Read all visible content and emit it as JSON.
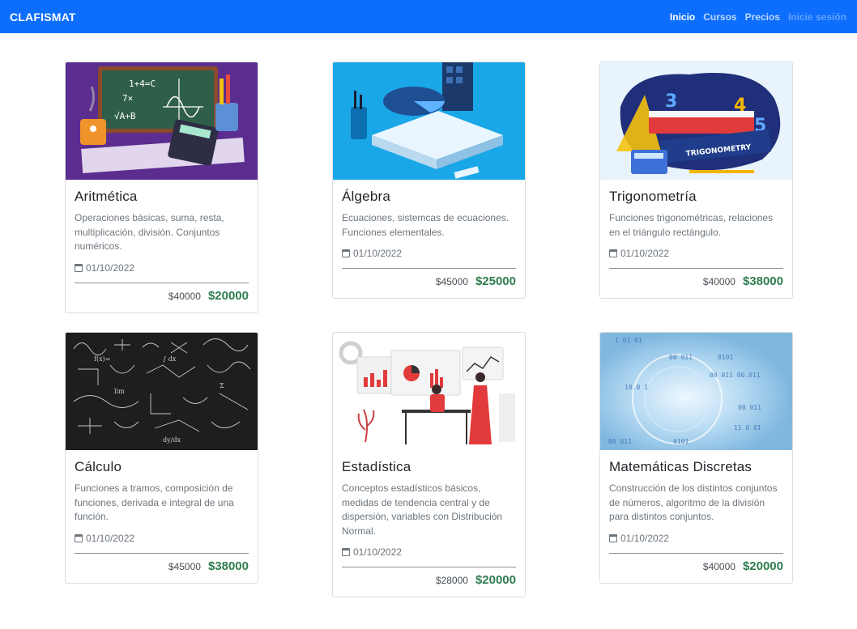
{
  "nav": {
    "brand": "CLAFISMAT",
    "links": [
      {
        "label": "Inicio",
        "state": "active"
      },
      {
        "label": "Cursos",
        "state": "normal"
      },
      {
        "label": "Precios",
        "state": "normal"
      },
      {
        "label": "Inicie sesión",
        "state": "disabled"
      }
    ]
  },
  "courses": [
    {
      "title": "Aritmética",
      "description": "Operaciones básicas, suma, resta, multiplicación, división. Conjuntos numéricos.",
      "date": "01/10/2022",
      "old_price": "$40000",
      "new_price": "$20000",
      "image_icon": "arithmetic-illustration"
    },
    {
      "title": "Álgebra",
      "description": "Ecuaciones, sistemcas de ecuaciones. Funciones elementales.",
      "date": "01/10/2022",
      "old_price": "$45000",
      "new_price": "$25000",
      "image_icon": "algebra-illustration"
    },
    {
      "title": "Trigonometría",
      "description": "Funciones trigonométricas, relaciones en el triángulo rectángulo.",
      "date": "01/10/2022",
      "old_price": "$40000",
      "new_price": "$38000",
      "image_icon": "trigonometry-illustration"
    },
    {
      "title": "Cálculo",
      "description": "Funciones a tramos, composición de funciones, derivada e integral de una función.",
      "date": "01/10/2022",
      "old_price": "$45000",
      "new_price": "$38000",
      "image_icon": "calculus-chalkboard-illustration"
    },
    {
      "title": "Estadística",
      "description": "Conceptos estadísticos básicos, medidas de tendencia central y de dispersión, variables con Distribución Normal.",
      "date": "01/10/2022",
      "old_price": "$28000",
      "new_price": "$20000",
      "image_icon": "statistics-illustration"
    },
    {
      "title": "Matemáticas Discretas",
      "description": "Construcción de los distintos conjuntos de números, algoritmo de la división para distintos conjuntos.",
      "date": "01/10/2022",
      "old_price": "$40000",
      "new_price": "$20000",
      "image_icon": "discrete-math-illustration"
    }
  ],
  "colors": {
    "navbar": "#0d6efd",
    "price": "#2e7d4f"
  }
}
